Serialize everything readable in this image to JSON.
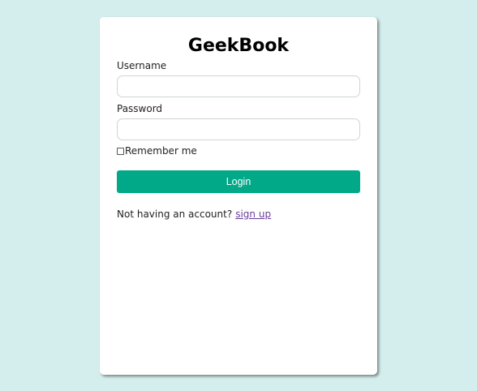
{
  "page": {
    "background_color": "#d4eded"
  },
  "login_card": {
    "title": "GeekBook",
    "username": {
      "label": "Username",
      "value": "",
      "placeholder": ""
    },
    "password": {
      "label": "Password",
      "value": "",
      "placeholder": ""
    },
    "remember_me": {
      "label": "Remember me",
      "checked": false
    },
    "login_button": {
      "label": "Login",
      "color": "#01a988"
    },
    "signup": {
      "prompt": "Not having an account?",
      "link_label": "sign up",
      "link_color": "#6a3d9a"
    }
  }
}
